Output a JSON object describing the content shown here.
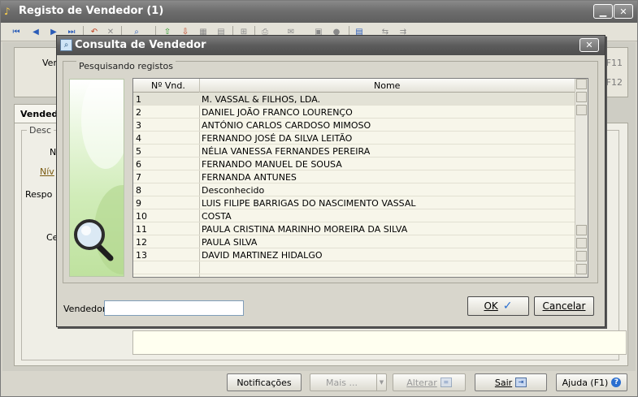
{
  "main_window": {
    "title": "Registo de Vendedor (1)",
    "min_glyph": "▁",
    "close_glyph": "✕",
    "toolbar_icons": [
      "first-record-icon",
      "prev-record-icon",
      "next-record-icon",
      "last-record-icon",
      "undo-icon",
      "cancel-icon",
      "find-icon",
      "import-icon",
      "export-icon",
      "grid-icon",
      "table-icon",
      "tree-icon",
      "print-icon",
      "send-icon",
      "preview-icon",
      "info-icon",
      "doc-icon",
      "link-icon",
      "link2-icon"
    ],
    "top_panel": {
      "label_partial": "Ver",
      "hotkey1": "F11",
      "hotkey2": "F12"
    },
    "tab_label": "Vendedo",
    "group_legend": "Desc",
    "fields_partial": [
      "N",
      "Nív",
      "Respo",
      "Ce",
      "I"
    ]
  },
  "bottom_buttons": {
    "notificacoes": "Notificações",
    "mais": "Mais ...",
    "alterar": "Alterar",
    "sair": "Sair",
    "ajuda": "Ajuda (F1)"
  },
  "dialog": {
    "title": "Consulta de Vendedor",
    "close_glyph": "✕",
    "group_legend": "Pesquisando registos",
    "columns": [
      "Nº Vnd.",
      "Nome"
    ],
    "rows": [
      {
        "num": "1",
        "name": "M. VASSAL & FILHOS, LDA."
      },
      {
        "num": "2",
        "name": "DANIEL JOÃO FRANCO LOURENÇO"
      },
      {
        "num": "3",
        "name": "ANTÓNIO CARLOS CARDOSO MIMOSO"
      },
      {
        "num": "4",
        "name": "FERNANDO JOSÉ DA SILVA LEITÃO"
      },
      {
        "num": "5",
        "name": "NÉLIA VANESSA FERNANDES PEREIRA"
      },
      {
        "num": "6",
        "name": "FERNANDO MANUEL DE SOUSA"
      },
      {
        "num": "7",
        "name": "FERNANDA ANTUNES"
      },
      {
        "num": "8",
        "name": "Desconhecido"
      },
      {
        "num": "9",
        "name": "LUIS FILIPE BARRIGAS DO NASCIMENTO VASSAL"
      },
      {
        "num": "10",
        "name": "COSTA"
      },
      {
        "num": "11",
        "name": "PAULA CRISTINA MARINHO MOREIRA DA SILVA"
      },
      {
        "num": "12",
        "name": "PAULA SILVA"
      },
      {
        "num": "13",
        "name": "DAVID MARTINEZ HIDALGO"
      }
    ],
    "vendedor_label": "Vendedor:",
    "vendedor_value": "",
    "ok_label": "OK",
    "cancel_label": "Cancelar"
  },
  "colors": {
    "title_bar": "#6e6e6e",
    "selected_row": "#e3e2d6",
    "accent": "#2b6fd0"
  }
}
